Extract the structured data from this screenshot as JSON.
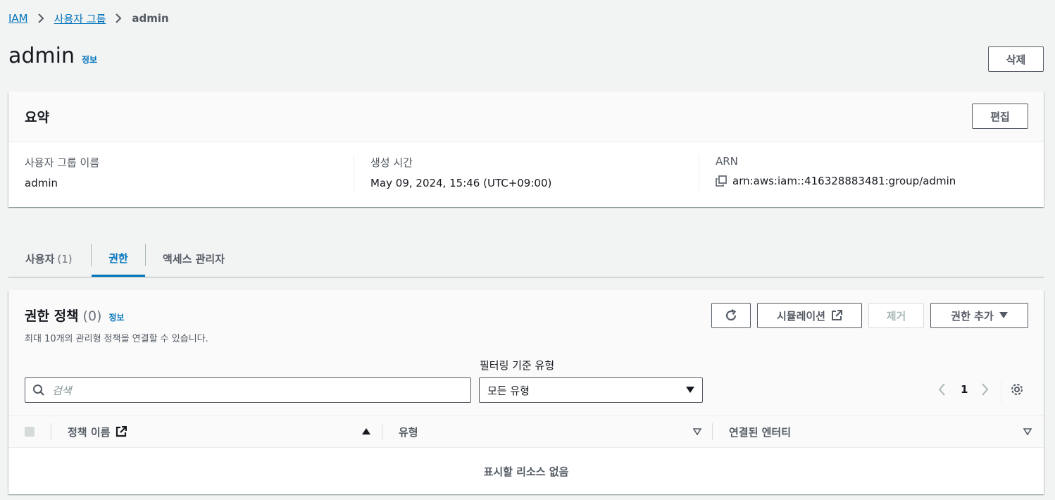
{
  "breadcrumb": {
    "items": [
      "IAM",
      "사용자 그룹"
    ],
    "current": "admin"
  },
  "page": {
    "title": "admin",
    "info_label": "정보",
    "delete_label": "삭제"
  },
  "summary": {
    "title": "요약",
    "edit_label": "편집",
    "group_name_label": "사용자 그룹 이름",
    "group_name_value": "admin",
    "created_label": "생성 시간",
    "created_value": "May 09, 2024, 15:46 (UTC+09:00)",
    "arn_label": "ARN",
    "arn_value": "arn:aws:iam::416328883481:group/admin"
  },
  "tabs": [
    {
      "label": "사용자",
      "count": "(1)"
    },
    {
      "label": "권한",
      "count": ""
    },
    {
      "label": "액세스 관리자",
      "count": ""
    }
  ],
  "permissions": {
    "title": "권한 정책",
    "count": "(0)",
    "info_label": "정보",
    "description": "최대 10개의 관리형 정책을 연결할 수 있습니다.",
    "simulation_label": "시뮬레이션",
    "remove_label": "제거",
    "add_label": "권한 추가",
    "search_placeholder": "검색",
    "filter_label": "필터링 기준 유형",
    "filter_value": "모든 유형",
    "page_number": "1",
    "columns": [
      "정책 이름",
      "유형",
      "연결된 엔터티"
    ],
    "empty_text": "표시할 리소스 없음"
  },
  "colors": {
    "link": "#0073bb",
    "text": "#16191f",
    "muted": "#545b64",
    "background": "#f2f3f3"
  }
}
